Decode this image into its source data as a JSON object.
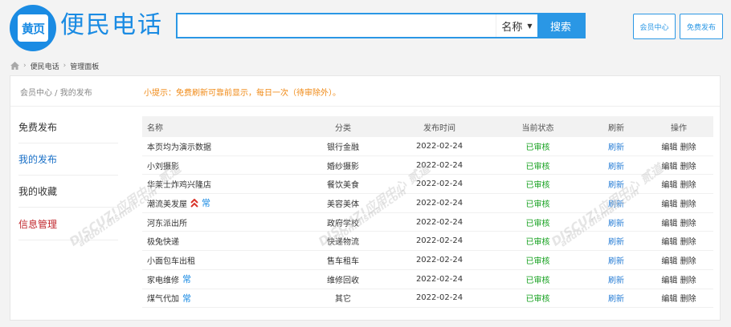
{
  "header": {
    "logo_badge": "黄页",
    "site_name": "便民电话",
    "search_placeholder": "",
    "search_select": "名称",
    "search_button": "搜索",
    "member_center_button": "会员中心",
    "free_publish_button": "免费发布"
  },
  "breadcrumb": {
    "items": [
      "便民电话",
      "管理面板"
    ]
  },
  "panel": {
    "crumb": "会员中心 / 我的发布",
    "tip": "小提示：免费刷新可靠前显示，每日一次（待审除外）。"
  },
  "sidebar": {
    "items": [
      {
        "label": "免费发布"
      },
      {
        "label": "我的发布"
      },
      {
        "label": "我的收藏"
      },
      {
        "label": "信息管理"
      }
    ]
  },
  "table": {
    "headers": {
      "name": "名称",
      "category": "分类",
      "time": "发布时间",
      "status": "当前状态",
      "refresh": "刷新",
      "op": "操作"
    },
    "rows": [
      {
        "name": "本页均为演示数据",
        "category": "银行金融",
        "time": "2022-02-24",
        "status": "已审核",
        "refresh": "刷新",
        "edit": "编辑",
        "delete": "删除",
        "top": false,
        "chang": ""
      },
      {
        "name": "小刘摄影",
        "category": "婚纱摄影",
        "time": "2022-02-24",
        "status": "已审核",
        "refresh": "刷新",
        "edit": "编辑",
        "delete": "删除",
        "top": false,
        "chang": ""
      },
      {
        "name": "华莱士炸鸡兴隆店",
        "category": "餐饮美食",
        "time": "2022-02-24",
        "status": "已审核",
        "refresh": "刷新",
        "edit": "编辑",
        "delete": "删除",
        "top": false,
        "chang": ""
      },
      {
        "name": "潮流美发屋",
        "category": "美容美体",
        "time": "2022-02-24",
        "status": "已审核",
        "refresh": "刷新",
        "edit": "编辑",
        "delete": "删除",
        "top": true,
        "chang": "常"
      },
      {
        "name": "河东派出所",
        "category": "政府学校",
        "time": "2022-02-24",
        "status": "已审核",
        "refresh": "刷新",
        "edit": "编辑",
        "delete": "删除",
        "top": false,
        "chang": ""
      },
      {
        "name": "极兔快递",
        "category": "快递物流",
        "time": "2022-02-24",
        "status": "已审核",
        "refresh": "刷新",
        "edit": "编辑",
        "delete": "删除",
        "top": false,
        "chang": ""
      },
      {
        "name": "小面包车出租",
        "category": "售车租车",
        "time": "2022-02-24",
        "status": "已审核",
        "refresh": "刷新",
        "edit": "编辑",
        "delete": "删除",
        "top": false,
        "chang": ""
      },
      {
        "name": "家电维修",
        "category": "维修回收",
        "time": "2022-02-24",
        "status": "已审核",
        "refresh": "刷新",
        "edit": "编辑",
        "delete": "删除",
        "top": false,
        "chang": "常"
      },
      {
        "name": "煤气代加",
        "category": "其它",
        "time": "2022-02-24",
        "status": "已审核",
        "refresh": "刷新",
        "edit": "编辑",
        "delete": "删除",
        "top": false,
        "chang": "常"
      }
    ]
  },
  "watermark": {
    "brand": "DISCUZ!应用中心",
    "domain": "addon.dismall.com",
    "mark": "贰道"
  },
  "colors": {
    "primary": "#1a8be3",
    "tip": "#f08a16",
    "approved": "#14a01e",
    "active_side": "#1a70c7",
    "info_manage": "#c1272d"
  }
}
